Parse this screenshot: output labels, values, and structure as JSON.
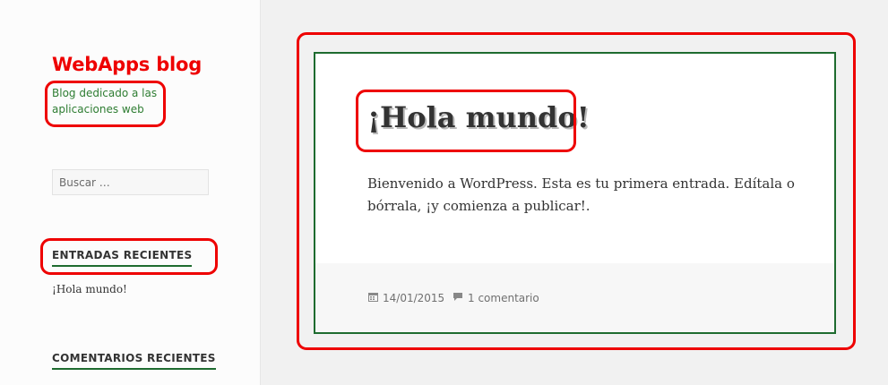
{
  "site": {
    "title": "WebApps blog",
    "description": "Blog dedicado a las aplicaciones web"
  },
  "search": {
    "placeholder": "Buscar …"
  },
  "widgets": {
    "recent_posts": {
      "title": "ENTRADAS RECIENTES",
      "items": [
        "¡Hola mundo!"
      ]
    },
    "recent_comments": {
      "title": "COMENTARIOS RECIENTES"
    }
  },
  "post": {
    "title": "¡Hola mundo!",
    "body": "Bienvenido a WordPress. Esta es tu primera entrada. Edítala o bórrala, ¡y comienza a publicar!.",
    "date": "14/01/2015",
    "comments": "1 comentario",
    "date_icon": "calendar-icon",
    "comments_icon": "comment-icon"
  },
  "colors": {
    "annotation": "#ee0000",
    "accent": "#1e6b2f",
    "tagline": "#2e7d32"
  }
}
